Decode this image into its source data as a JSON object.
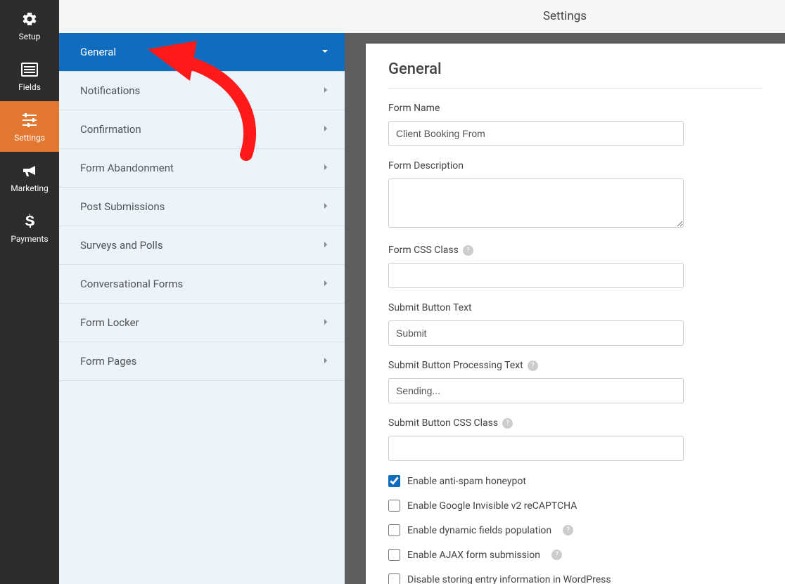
{
  "header": {
    "title": "Settings"
  },
  "iconbar": {
    "items": [
      {
        "label": "Setup",
        "icon": "gear"
      },
      {
        "label": "Fields",
        "icon": "list"
      },
      {
        "label": "Settings",
        "icon": "sliders",
        "active": true
      },
      {
        "label": "Marketing",
        "icon": "bullhorn"
      },
      {
        "label": "Payments",
        "icon": "dollar"
      }
    ]
  },
  "settings_menu": {
    "items": [
      {
        "label": "General",
        "active": true
      },
      {
        "label": "Notifications"
      },
      {
        "label": "Confirmation"
      },
      {
        "label": "Form Abandonment"
      },
      {
        "label": "Post Submissions"
      },
      {
        "label": "Surveys and Polls"
      },
      {
        "label": "Conversational Forms"
      },
      {
        "label": "Form Locker"
      },
      {
        "label": "Form Pages"
      }
    ]
  },
  "panel": {
    "title": "General",
    "form_name": {
      "label": "Form Name",
      "value": "Client Booking From"
    },
    "form_description": {
      "label": "Form Description",
      "value": ""
    },
    "form_css_class": {
      "label": "Form CSS Class",
      "value": ""
    },
    "submit_text": {
      "label": "Submit Button Text",
      "value": "Submit"
    },
    "submit_processing": {
      "label": "Submit Button Processing Text",
      "value": "Sending..."
    },
    "submit_css": {
      "label": "Submit Button CSS Class",
      "value": ""
    },
    "checks": [
      {
        "label": "Enable anti-spam honeypot",
        "checked": true
      },
      {
        "label": "Enable Google Invisible v2 reCAPTCHA",
        "checked": false
      },
      {
        "label": "Enable dynamic fields population",
        "checked": false,
        "help": true
      },
      {
        "label": "Enable AJAX form submission",
        "checked": false,
        "help": true
      },
      {
        "label": "Disable storing entry information in WordPress",
        "checked": false
      }
    ]
  }
}
